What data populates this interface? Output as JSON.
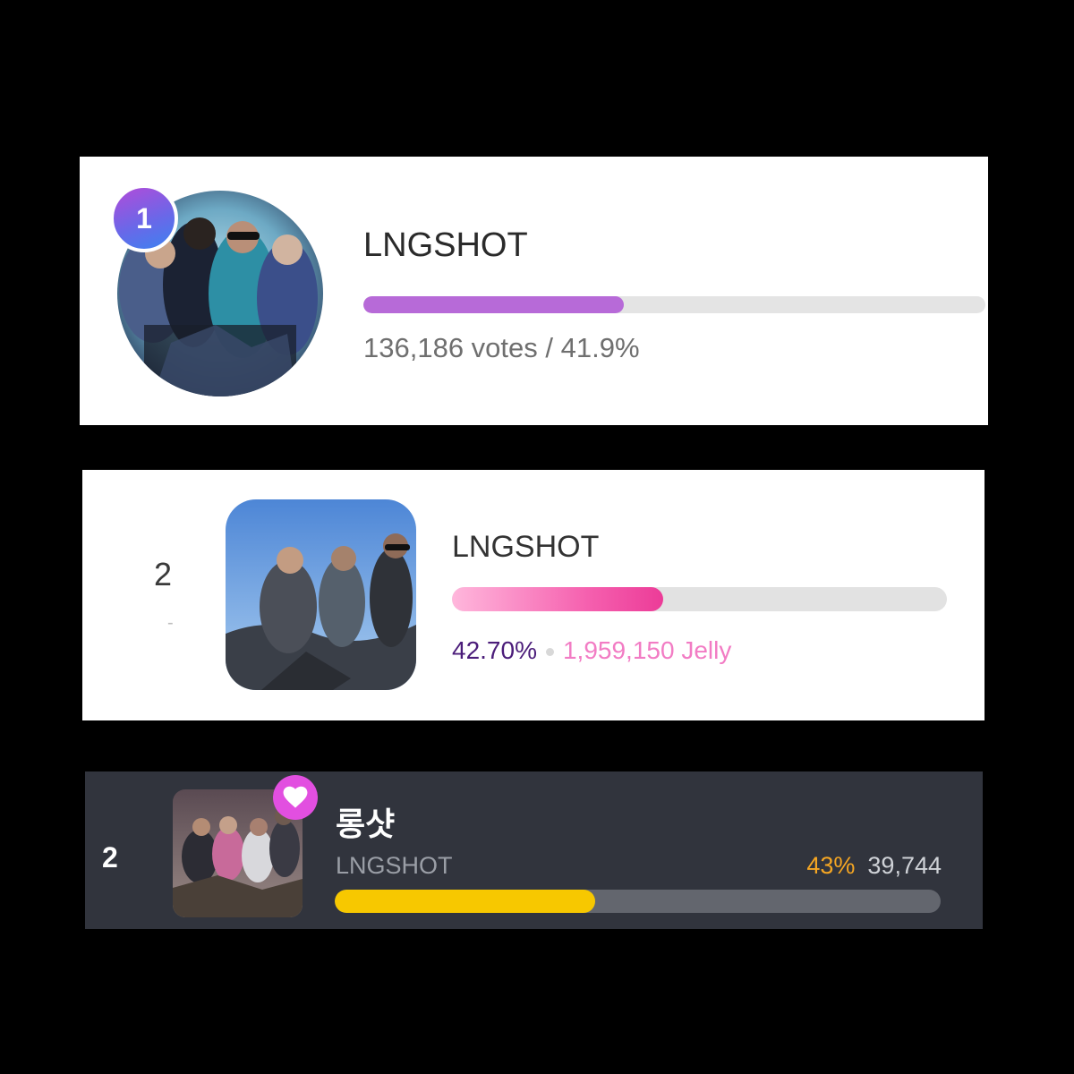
{
  "card1": {
    "rank": "1",
    "artist_name": "LNGSHOT",
    "vote_fraction": 0.419,
    "stats_text": "136,186 votes / 41.9%",
    "bar_color": "#b76ad8"
  },
  "card2": {
    "rank": "2",
    "rank_change": "-",
    "artist_name": "LNGSHOT",
    "percent_text": "42.70%",
    "jelly_text": "1,959,150 Jelly",
    "vote_fraction": 0.427,
    "bar_color": "#f55fae"
  },
  "card3": {
    "rank": "2",
    "korean_name": "롱샷",
    "artist_name": "LNGSHOT",
    "percent_text": "43%",
    "count_text": "39,744",
    "vote_fraction": 0.43,
    "bar_color": "#f7c800",
    "badge_icon": "heart-icon"
  }
}
